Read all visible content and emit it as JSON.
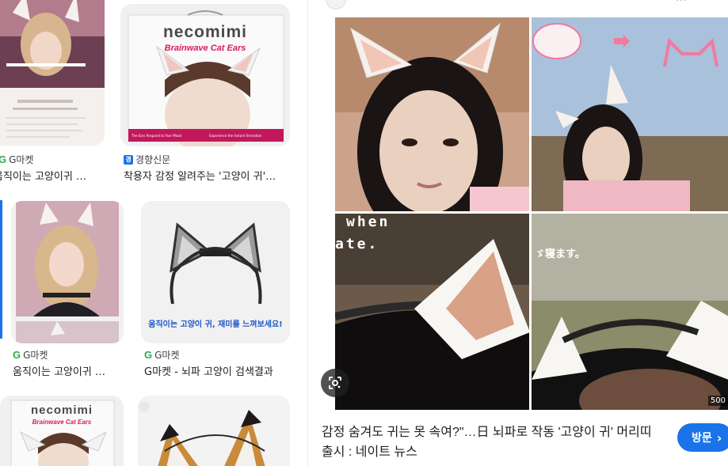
{
  "results": [
    {
      "source": "G마켓",
      "title": "움직이는 고양이귀 …",
      "logo_letter": "G"
    },
    {
      "source": "경향신문",
      "title": "착용자 감정 알려주는 '고양이 귀'…",
      "logo_letter": "경"
    },
    {
      "source": "G마켓",
      "title": "움직이는 고양이귀 …",
      "logo_letter": "G"
    },
    {
      "source": "G마켓",
      "title": "G마켓 - 뇌파 고양이 검색결과",
      "logo_letter": "G"
    }
  ],
  "box_brand": "necomimi",
  "box_subtitle": "Brainwave Cat Ears",
  "box_tagline": "The Ears Respond to Your Mood",
  "box_tagline2": "Experience the Instant Sensation",
  "product_banner": "움직이는 고양이 귀, 재미를 느껴보세요!",
  "preview": {
    "title": "감정 숨겨도 귀는 못 속여?\"…日 뇌파로 작동 '고양이 귀' 머리띠 출시 : 네이트 뉴스",
    "visit_label": "방문",
    "visit_arrow": "›",
    "size_badge": "500",
    "overlay_when": "when",
    "overlay_ate": "ate.",
    "overlay_jp": "ゞ寝ます。"
  },
  "colors": {
    "accent": "#1a73e8",
    "google_green": "#34a853"
  }
}
